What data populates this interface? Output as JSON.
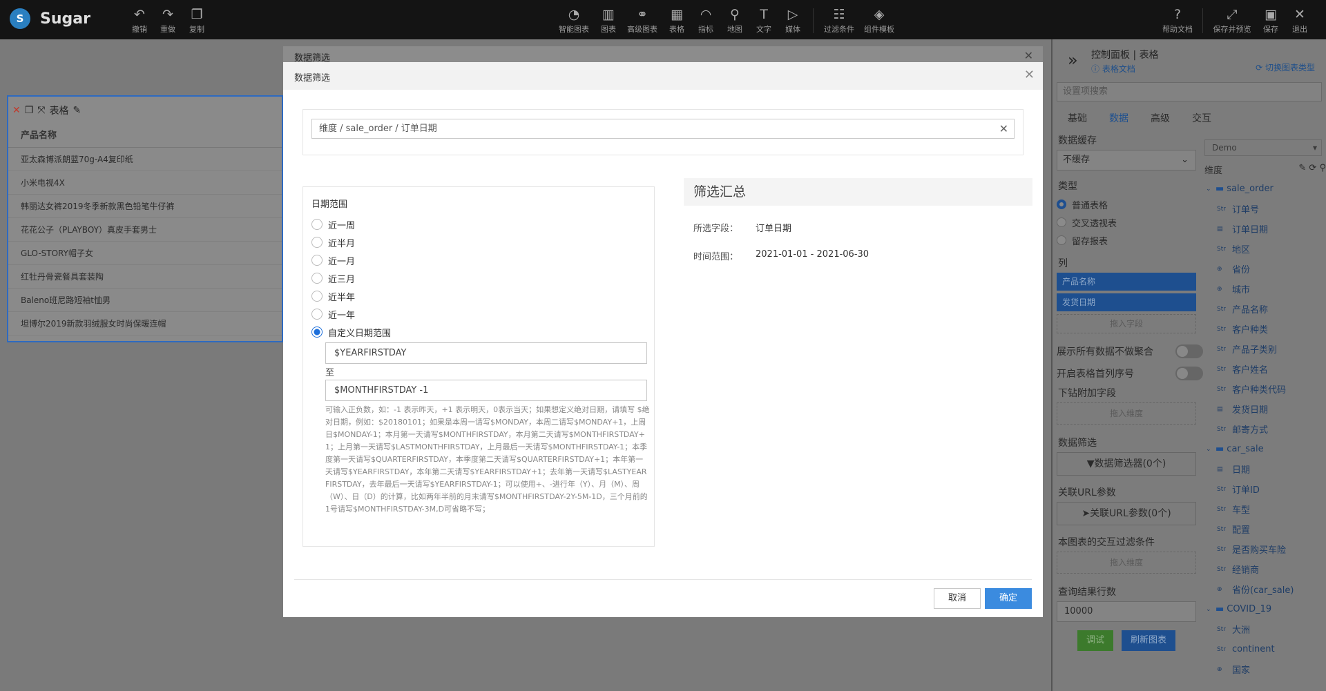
{
  "app": {
    "name": "Sugar",
    "logo_glyph": "S",
    "accent": "#3b8bdf"
  },
  "toolbar": {
    "undo": "撤销",
    "redo": "重做",
    "copy": "复制",
    "smart_chart": "智能图表",
    "chart": "图表",
    "advanced_chart": "高级图表",
    "table": "表格",
    "metric": "指标",
    "map": "地图",
    "text": "文字",
    "media": "媒体",
    "filter": "过滤条件",
    "component_template": "组件模板",
    "help": "帮助文档",
    "save_preview": "保存并预览",
    "save": "保存",
    "exit": "退出"
  },
  "bg_widget": {
    "title": "表格",
    "column": "产品名称",
    "rows": [
      "亚太森博派朗蓝70g-A4复印纸",
      "小米电视4X",
      "韩丽达女裤2019冬季新款黑色铅笔牛仔裤",
      "花花公子（PLAYBOY）真皮手套男士",
      "GLO-STORY帽子女",
      "红牡丹骨瓷餐具套装陶",
      "Baleno班尼路短袖t恤男",
      "坦博尔2019新款羽绒服女时尚保暖连帽"
    ]
  },
  "right_panel": {
    "title": "控制面板 | 表格",
    "doc_link": "表格文档",
    "switch_type": "切换图表类型",
    "search_placeholder": "设置项搜索",
    "tabs": [
      "基础",
      "数据",
      "高级",
      "交互"
    ],
    "cache_label": "数据缓存",
    "cache_value": "不缓存",
    "type_label": "类型",
    "types": [
      "普通表格",
      "交叉透视表",
      "留存报表"
    ],
    "columns_label": "列",
    "columns": [
      "产品名称",
      "发货日期"
    ],
    "drag_field": "拖入字段",
    "show_all_label": "展示所有数据不做聚合",
    "first_col_index_label": "开启表格首列序号",
    "drill_label": "下钻附加字段",
    "drag_dim": "拖入维度",
    "filter_label": "数据筛选",
    "filter_button": "数据筛选器(0个)",
    "url_label": "关联URL参数",
    "url_button": "关联URL参数(0个)",
    "interaction_label": "本图表的交互过滤条件",
    "interaction_drag": "拖入维度",
    "rows_label": "查询结果行数",
    "rows_value": "10000",
    "debug_button": "调试",
    "refresh_button": "刷新图表",
    "datasource": "Demo",
    "dim_label": "维度",
    "tree": [
      {
        "type": "folder",
        "name": "sale_order"
      },
      {
        "type": "str",
        "name": "订单号"
      },
      {
        "type": "date",
        "name": "订单日期"
      },
      {
        "type": "str",
        "name": "地区"
      },
      {
        "type": "geo",
        "name": "省份"
      },
      {
        "type": "geo",
        "name": "城市"
      },
      {
        "type": "str",
        "name": "产品名称"
      },
      {
        "type": "str",
        "name": "客户种类"
      },
      {
        "type": "str",
        "name": "产品子类别"
      },
      {
        "type": "str",
        "name": "客户姓名"
      },
      {
        "type": "str",
        "name": "客户种类代码"
      },
      {
        "type": "date",
        "name": "发货日期"
      },
      {
        "type": "str",
        "name": "邮寄方式"
      },
      {
        "type": "folder",
        "name": "car_sale"
      },
      {
        "type": "date",
        "name": "日期"
      },
      {
        "type": "str",
        "name": "订单ID"
      },
      {
        "type": "str",
        "name": "车型"
      },
      {
        "type": "str",
        "name": "配置"
      },
      {
        "type": "str",
        "name": "是否购买车险"
      },
      {
        "type": "str",
        "name": "经销商"
      },
      {
        "type": "geo",
        "name": "省份(car_sale)"
      },
      {
        "type": "folder",
        "name": "COVID_19"
      },
      {
        "type": "str",
        "name": "大洲"
      },
      {
        "type": "str",
        "name": "continent"
      },
      {
        "type": "geo",
        "name": "国家"
      }
    ]
  },
  "back_dialog": {
    "title": "数据筛选"
  },
  "dialog": {
    "title": "数据筛选",
    "field_path": "维度 / sale_order / 订单日期",
    "range_label": "日期范围",
    "options": [
      "近一周",
      "近半月",
      "近一月",
      "近三月",
      "近半年",
      "近一年",
      "自定义日期范围"
    ],
    "selected_option": "自定义日期范围",
    "start_value": "$YEARFIRSTDAY",
    "to_label": "至",
    "end_value": "$MONTHFIRSTDAY -1",
    "hint": "可输入正负数，如：-1 表示昨天，+1 表示明天，0表示当天；如果想定义绝对日期，请填写 $绝对日期，例如：$20180101；如果是本周一请写$MONDAY，本周二请写$MONDAY+1，上周日$MONDAY-1；本月第一天请写$MONTHFIRSTDAY，本月第二天请写$MONTHFIRSTDAY+1；上月第一天请写$LASTMONTHFIRSTDAY，上月最后一天请写$MONTHFIRSTDAY-1；本季度第一天请写$QUARTERFIRSTDAY，本季度第二天请写$QUARTERFIRSTDAY+1；本年第一天请写$YEARFIRSTDAY，本年第二天请写$YEARFIRSTDAY+1；去年第一天请写$LASTYEARFIRSTDAY，去年最后一天请写$YEARFIRSTDAY-1；可以使用+、-进行年（Y）、月（M）、周（W）、日（D）的计算，比如两年半前的月末请写$MONTHFIRSTDAY-2Y-5M-1D，三个月前的1号请写$MONTHFIRSTDAY-3M,D可省略不写；",
    "summary_title": "筛选汇总",
    "summary_field_key": "所选字段：",
    "summary_field_value": "订单日期",
    "summary_range_key": "时间范围：",
    "summary_range_value": "2021-01-01 - 2021-06-30",
    "cancel": "取消",
    "ok": "确定"
  }
}
